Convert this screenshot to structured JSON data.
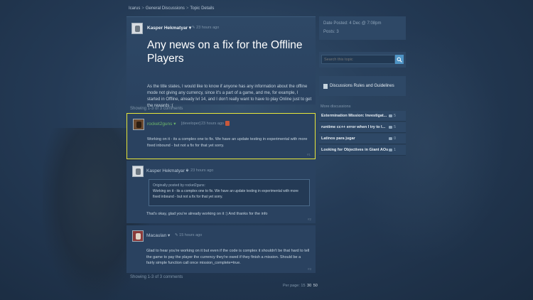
{
  "breadcrumb": {
    "game": "Icarus",
    "section": "General Discussions",
    "page": "Topic Details"
  },
  "op": {
    "author": "Kasper Hekmatyar",
    "time": "23 hours ago",
    "title": "Any news on a fix for the Offline Players",
    "body": "As the title states, I would like to know if anyone has any information about the offline mode not giving any currency, since it's a part of a game, and me, for example, I started in Offline, already lvl 14, and I don't really want to have to play Online just to get the rewards :("
  },
  "showing_top": "Showing 1-3 of 3 comments",
  "showing_bottom": "Showing 1-3 of 3 comments",
  "comments": [
    {
      "author": "rocket2guns",
      "label": "[developer]",
      "time": "23 hours ago",
      "body": "Working on it - its a complex one to fix. We have an update testing in experimental with more fixed inbound - but not a fix for that yet sorry.",
      "num": "#1"
    },
    {
      "author": "Kasper Hekmatyar",
      "time": "23 hours ago",
      "quote_head": "Originally posted by rocket2guns:",
      "quote_body": "Working on it - its a complex one to fix. We have an update testing in experimental with more fixed inbound - but not a fix for that yet sorry.",
      "body": "That's okay, glad you're already working on it :) And thanks for the info",
      "num": "#2"
    },
    {
      "author": "Macaulan",
      "time": "15 hours ago",
      "body": "Glad to hear you're working on it but even if the code is complex it shouldn't be that hard to tell the game to pay the player the currency they're owed if they finish a mission. Should be a fairly simple function call once mission_complete=true.",
      "num": "#3"
    }
  ],
  "pager": {
    "label": "Per page:",
    "options": [
      "15",
      "30",
      "50"
    ]
  },
  "info": {
    "date_posted": "Date Posted: 4 Dec @ 7:08pm",
    "posts": "Posts: 3"
  },
  "search": {
    "placeholder": "Search this topic"
  },
  "rules_label": "Discussions Rules and Guidelines",
  "more": {
    "label": "More discussions",
    "items": [
      {
        "title": "Extermination Mission: Investigat...",
        "count": "5"
      },
      {
        "title": "runtime cc++ error when I try to l...",
        "count": "5"
      },
      {
        "title": "Latinos para jugar",
        "count": "0"
      },
      {
        "title": "Looking for Objectives in Giant AOs",
        "count": "1"
      }
    ]
  },
  "colors": {
    "highlight": "#e8e63a",
    "accent": "#4e93c4"
  }
}
